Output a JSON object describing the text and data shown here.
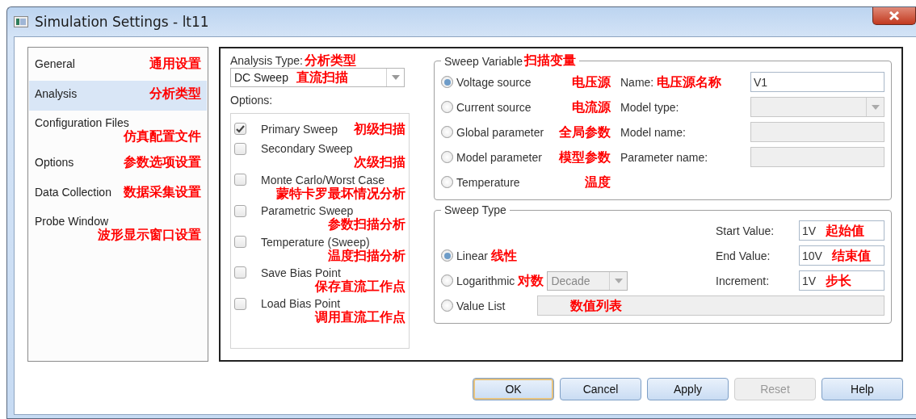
{
  "window": {
    "title": "Simulation Settings - lt11"
  },
  "sidebar": {
    "items": [
      {
        "label": "General",
        "note": "通用设置",
        "selected": false
      },
      {
        "label": "Analysis",
        "note": "分析类型",
        "selected": true
      },
      {
        "label": "Configuration Files",
        "note": "仿真配置文件",
        "selected": false
      },
      {
        "label": "Options",
        "note": "参数选项设置",
        "selected": false
      },
      {
        "label": "Data Collection",
        "note": "数据采集设置",
        "selected": false
      },
      {
        "label": "Probe Window",
        "note": "波形显示窗口设置",
        "selected": false
      }
    ]
  },
  "analysis_type": {
    "label": "Analysis Type:",
    "note": "分析类型",
    "value": "DC Sweep",
    "value_note": "直流扫描"
  },
  "options": {
    "label": "Options:",
    "items": [
      {
        "label": "Primary Sweep",
        "note": "初级扫描",
        "checked": true
      },
      {
        "label": "Secondary Sweep",
        "note": "次级扫描",
        "checked": false
      },
      {
        "label": "Monte Carlo/Worst Case",
        "note": "蒙特卡罗最坏情况分析",
        "checked": false
      },
      {
        "label": "Parametric Sweep",
        "note": "参数扫描分析",
        "checked": false
      },
      {
        "label": "Temperature (Sweep)",
        "note": "温度扫描分析",
        "checked": false
      },
      {
        "label": "Save Bias Point",
        "note": "保存直流工作点",
        "checked": false
      },
      {
        "label": "Load Bias Point",
        "note": "调用直流工作点",
        "checked": false
      }
    ]
  },
  "sweep_variable": {
    "title": "Sweep Variable",
    "title_note": "扫描变量",
    "choices": [
      {
        "label": "Voltage source",
        "note": "电压源",
        "selected": true
      },
      {
        "label": "Current source",
        "note": "电流源",
        "selected": false
      },
      {
        "label": "Global parameter",
        "note": "全局参数",
        "selected": false
      },
      {
        "label": "Model parameter",
        "note": "模型参数",
        "selected": false
      },
      {
        "label": "Temperature",
        "note": "温度",
        "selected": false
      }
    ],
    "fields": [
      {
        "label": "Name:",
        "note": "电压源名称",
        "kind": "text",
        "value": "V1",
        "disabled": false
      },
      {
        "label": "Model type:",
        "kind": "select",
        "disabled": true
      },
      {
        "label": "Model name:",
        "kind": "text",
        "disabled": true
      },
      {
        "label": "Parameter name:",
        "kind": "text",
        "disabled": true
      }
    ]
  },
  "sweep_type": {
    "title": "Sweep Type",
    "fields": [
      {
        "label": "Start Value:",
        "value": "1V",
        "note": "起始值"
      },
      {
        "label": "End Value:",
        "value": "10V",
        "note": "结束值"
      },
      {
        "label": "Increment:",
        "value": "1V",
        "note": "步长"
      }
    ],
    "choices": [
      {
        "label": "Linear",
        "note": "线性",
        "selected": true
      },
      {
        "label": "Logarithmic",
        "note": "对数",
        "selected": false,
        "select_value": "Decade",
        "select_disabled": true
      },
      {
        "label": "Value List",
        "selected": false,
        "list_note": "数值列表",
        "list_disabled": true
      }
    ]
  },
  "buttons": [
    {
      "label": "OK",
      "default": true,
      "disabled": false
    },
    {
      "label": "Cancel",
      "default": false,
      "disabled": false
    },
    {
      "label": "Apply",
      "default": false,
      "disabled": false
    },
    {
      "label": "Reset",
      "default": false,
      "disabled": true
    },
    {
      "label": "Help",
      "default": false,
      "disabled": false
    }
  ]
}
